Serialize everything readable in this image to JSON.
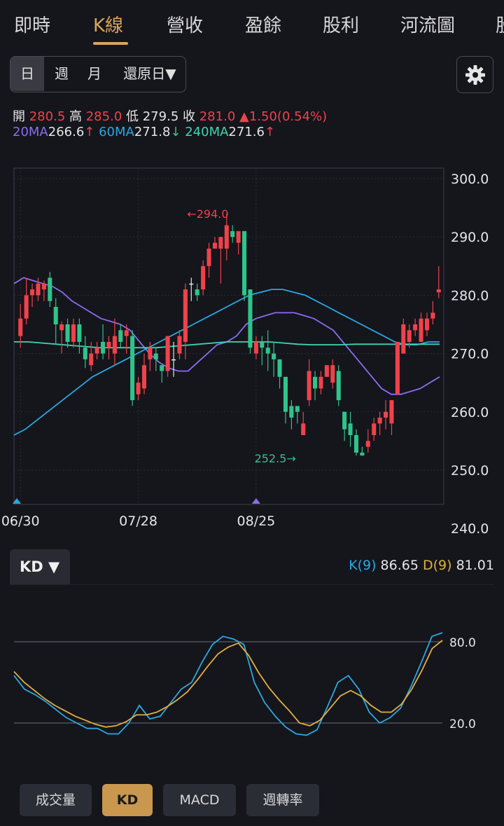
{
  "tabs": [
    {
      "label": "即時"
    },
    {
      "label": "K線"
    },
    {
      "label": "營收"
    },
    {
      "label": "盈餘"
    },
    {
      "label": "股利"
    },
    {
      "label": "河流圖"
    },
    {
      "label": "股"
    }
  ],
  "active_tab": "K線",
  "periods": [
    {
      "label": "日"
    },
    {
      "label": "週"
    },
    {
      "label": "月"
    },
    {
      "label": "還原日▼"
    }
  ],
  "active_period": "日",
  "quote": {
    "open_label": "開",
    "open": "280.5",
    "high_label": "高",
    "high": "285.0",
    "low_label": "低",
    "low": "279.5",
    "close_label": "收",
    "close": "281.0",
    "change": "▲1.50(0.54%)"
  },
  "ma": {
    "ma20_label": "20MA",
    "ma20": "266.6",
    "ma20_arrow": "↑",
    "ma60_label": "60MA",
    "ma60": "271.8",
    "ma60_arrow": "↓",
    "ma240_label": "240MA",
    "ma240": "271.6",
    "ma240_arrow": "↑"
  },
  "colors": {
    "up": "#f0424a",
    "down": "#2fc48a",
    "ma20": "#8c6cf0",
    "ma60": "#2aa8e0",
    "ma240": "#3fd6b0",
    "k": "#2aa8e0",
    "d": "#e0b040",
    "accent": "#d9a55a"
  },
  "kd": {
    "selector": "KD ▼",
    "k_label": "K(9)",
    "k": "86.65",
    "d_label": "D(9)",
    "d": "81.01"
  },
  "indicator_buttons": [
    {
      "label": "成交量"
    },
    {
      "label": "KD"
    },
    {
      "label": "MACD"
    },
    {
      "label": "週轉率"
    }
  ],
  "active_indicator": "KD",
  "icons": {
    "settings": "gear-icon",
    "scroll_left": "triangle-up-icon",
    "scroll_right": "triangle-up-icon"
  },
  "chart_data": [
    {
      "type": "candlestick",
      "yticks": [
        "300.0",
        "290.0",
        "280.0",
        "270.0",
        "260.0",
        "250.0",
        "240.0"
      ],
      "ylim": [
        240,
        300
      ],
      "xticks": [
        {
          "label": "06/30",
          "index": 0
        },
        {
          "label": "07/28",
          "index": 20
        },
        {
          "label": "08/25",
          "index": 40
        }
      ],
      "annotations": [
        {
          "text": "←294.0",
          "index": 29,
          "value": 294.0
        },
        {
          "text": "252.5→",
          "index": 47,
          "value": 252.5
        }
      ],
      "candles": [
        [
          273,
          276,
          278.5,
          271
        ],
        [
          276,
          280,
          283,
          275
        ],
        [
          280,
          281,
          282,
          278
        ],
        [
          280,
          282,
          283,
          279
        ],
        [
          281,
          282,
          282.5,
          279
        ],
        [
          283,
          279,
          284,
          278
        ],
        [
          278,
          275,
          279.5,
          271.5
        ],
        [
          274,
          275,
          275.5,
          270
        ],
        [
          275,
          272,
          276,
          271
        ],
        [
          272,
          275,
          276,
          271
        ],
        [
          275,
          272,
          276,
          270
        ],
        [
          271,
          269,
          273,
          267.5
        ],
        [
          268,
          270,
          272,
          267
        ],
        [
          270,
          271,
          272,
          269
        ],
        [
          272,
          270,
          275,
          269
        ],
        [
          271,
          272,
          273,
          269
        ],
        [
          270,
          273,
          276,
          268
        ],
        [
          274,
          272,
          275,
          271
        ],
        [
          273,
          274,
          275,
          270
        ],
        [
          273,
          262,
          274,
          261
        ],
        [
          263,
          265,
          266,
          262
        ],
        [
          264,
          268,
          270,
          263
        ],
        [
          269,
          271,
          272,
          267
        ],
        [
          270,
          269,
          271,
          267
        ],
        [
          268,
          267,
          268,
          265
        ],
        [
          267,
          273,
          273,
          266
        ],
        [
          269,
          269,
          272,
          266
        ],
        [
          270,
          273,
          274,
          269
        ],
        [
          272,
          281,
          282,
          269
        ],
        [
          282,
          282,
          283,
          279
        ],
        [
          281,
          280,
          282,
          279
        ],
        [
          281,
          285,
          286,
          280
        ],
        [
          285,
          288,
          289,
          283
        ],
        [
          288,
          289,
          290,
          288
        ],
        [
          288,
          290,
          290,
          282
        ],
        [
          288,
          292,
          294,
          286
        ],
        [
          291,
          290,
          292,
          289
        ],
        [
          289,
          291,
          291,
          287
        ],
        [
          291,
          280,
          291,
          279
        ],
        [
          281,
          271,
          281,
          270
        ],
        [
          270,
          272,
          273,
          269
        ],
        [
          272,
          271,
          273,
          268
        ],
        [
          271,
          270,
          274,
          267
        ],
        [
          270,
          269,
          272,
          266
        ],
        [
          269,
          266,
          269,
          264
        ],
        [
          266,
          260,
          266,
          258
        ],
        [
          261,
          259,
          262,
          257
        ],
        [
          261,
          260,
          261,
          258
        ],
        [
          256,
          258,
          260,
          256
        ],
        [
          262,
          267,
          269,
          261
        ],
        [
          266,
          264,
          267,
          262
        ],
        [
          264,
          266,
          267,
          263
        ],
        [
          266,
          268,
          268,
          266
        ],
        [
          265,
          268,
          269,
          264
        ],
        [
          267,
          262,
          268,
          261
        ],
        [
          260,
          257,
          260,
          255
        ],
        [
          258,
          256,
          260,
          254
        ],
        [
          256,
          253,
          257,
          252.5
        ],
        [
          253,
          252.5,
          254,
          252.5
        ],
        [
          254,
          255,
          257,
          253
        ],
        [
          256,
          258,
          259,
          255
        ],
        [
          258,
          259,
          260,
          256
        ],
        [
          259,
          260,
          262,
          257
        ],
        [
          258,
          262,
          262,
          256
        ],
        [
          263,
          272,
          272,
          266
        ],
        [
          270,
          275,
          276,
          271
        ],
        [
          272,
          274,
          275,
          271
        ],
        [
          274,
          275,
          276,
          273
        ],
        [
          272,
          276,
          277,
          272
        ],
        [
          274,
          276,
          277,
          273
        ],
        [
          276,
          277,
          279,
          275
        ],
        [
          280.5,
          281,
          285,
          279.5
        ]
      ],
      "ma20": [
        282,
        283,
        282.5,
        282,
        281.5,
        280.5,
        279,
        278,
        277,
        276,
        275.5,
        275,
        274,
        272,
        270,
        268.5,
        267.5,
        267,
        267,
        268.5,
        270,
        271.5,
        272,
        273,
        275,
        276,
        276.5,
        277,
        277,
        277,
        276.5,
        276,
        275,
        274,
        272,
        270,
        268,
        266,
        264,
        263,
        263,
        263.5,
        264,
        265,
        266
      ],
      "ma60": [
        256,
        257,
        258.5,
        260,
        261.5,
        263,
        264.5,
        266,
        267,
        268,
        269,
        270,
        271,
        272,
        273,
        274,
        275,
        276,
        277,
        278,
        279,
        280,
        280.5,
        281,
        281,
        280.5,
        280,
        279,
        278,
        277,
        276,
        275,
        274,
        273,
        272,
        271.5,
        271.5,
        272,
        272
      ],
      "ma240": [
        272,
        272,
        271.8,
        271.6,
        271.4,
        271.2,
        271,
        271,
        271,
        271,
        271,
        271.2,
        271.4,
        271.6,
        271.8,
        272,
        272,
        272,
        272,
        271.8,
        271.6,
        271.5,
        271.5,
        271.5,
        271.6,
        271.6,
        271.6,
        271.6,
        271.6,
        271.6,
        271.6
      ]
    },
    {
      "type": "line",
      "yticks": [
        "80.0",
        "20.0"
      ],
      "ylim": [
        0,
        100
      ],
      "series": [
        {
          "name": "K(9)",
          "values": [
            55,
            45,
            41,
            36,
            30,
            24,
            20,
            16,
            16,
            12,
            12,
            20,
            33,
            23,
            25,
            35,
            45,
            50,
            65,
            78,
            84,
            82,
            78,
            50,
            35,
            25,
            17,
            12,
            11,
            15,
            32,
            50,
            55,
            45,
            28,
            20,
            24,
            31,
            47,
            65,
            84,
            86.65
          ]
        },
        {
          "name": "D(9)",
          "values": [
            58,
            50,
            44,
            38,
            33,
            29,
            25,
            22,
            19,
            17,
            18,
            21,
            26,
            26,
            28,
            32,
            37,
            43,
            52,
            62,
            71,
            76,
            79,
            70,
            57,
            46,
            37,
            29,
            20,
            18,
            22,
            31,
            40,
            44,
            40,
            33,
            28,
            28,
            34,
            45,
            59,
            75,
            81.01
          ]
        }
      ]
    }
  ]
}
